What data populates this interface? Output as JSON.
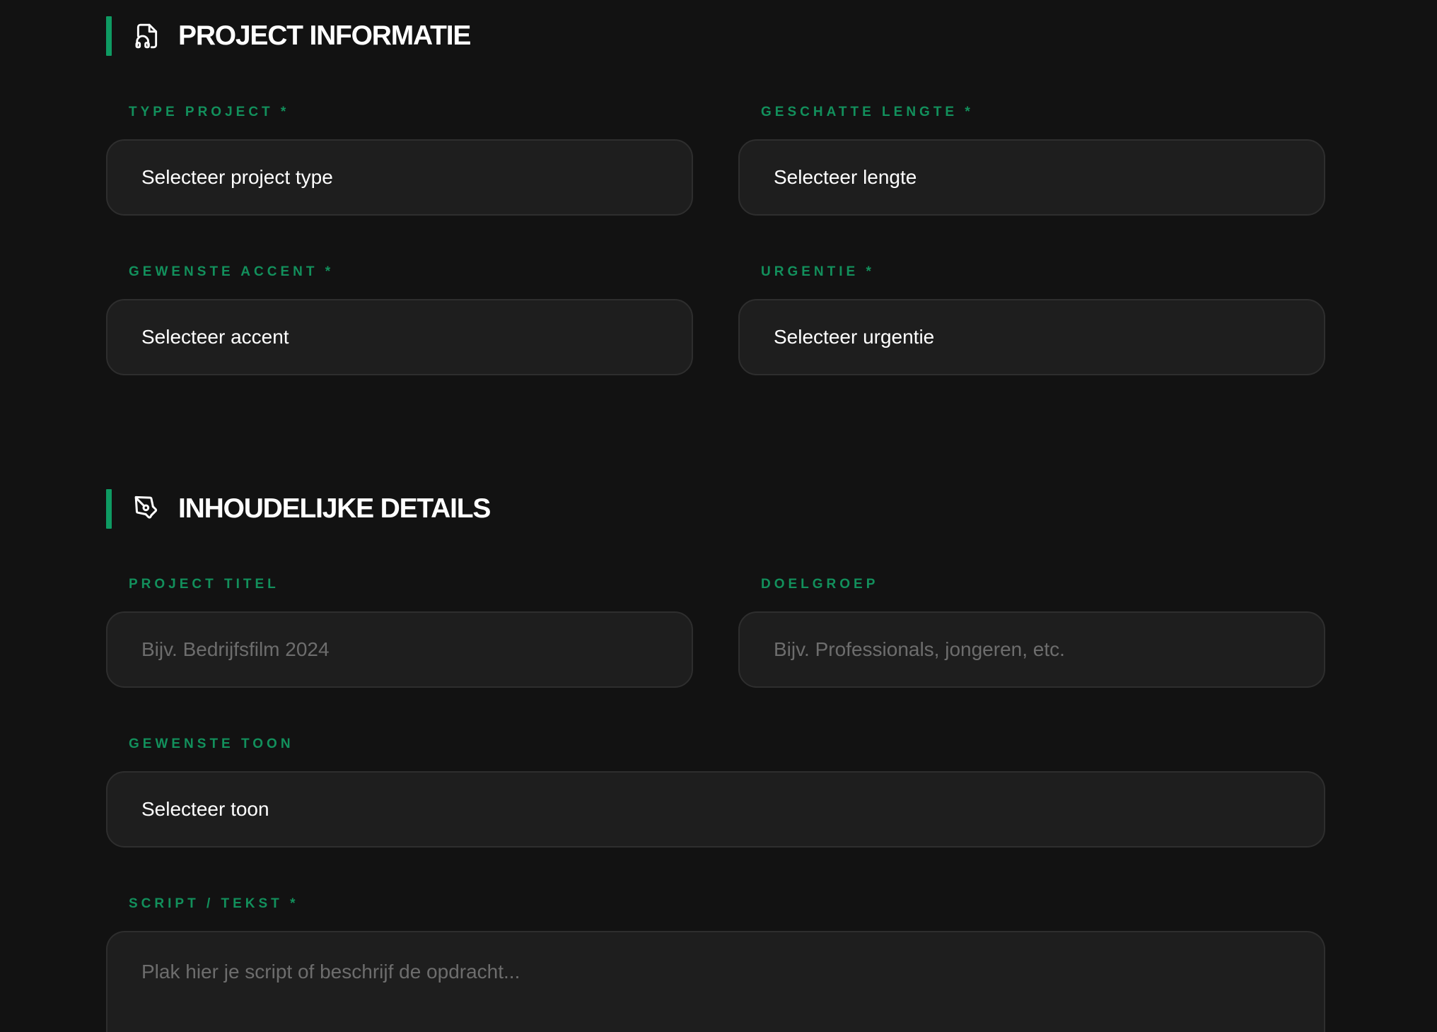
{
  "colors": {
    "background": "#121212",
    "accent": "#0e9a62",
    "label": "#12905c",
    "field_bg": "#1e1e1e",
    "field_border": "#2e2e2e",
    "placeholder": "#6d6d6d"
  },
  "project_info": {
    "icon": "document-headphones-icon",
    "title": "PROJECT INFORMATIE",
    "type_project": {
      "label": "TYPE PROJECT *",
      "value": "Selecteer project type"
    },
    "geschatte_lengte": {
      "label": "GESCHATTE LENGTE *",
      "value": "Selecteer lengte"
    },
    "gewenste_accent": {
      "label": "GEWENSTE ACCENT *",
      "value": "Selecteer accent"
    },
    "urgentie": {
      "label": "URGENTIE *",
      "value": "Selecteer urgentie"
    }
  },
  "content_details": {
    "icon": "pen-tool-icon",
    "title": "INHOUDELIJKE DETAILS",
    "project_titel": {
      "label": "PROJECT TITEL",
      "placeholder": "Bijv. Bedrijfsfilm 2024"
    },
    "doelgroep": {
      "label": "DOELGROEP",
      "placeholder": "Bijv. Professionals, jongeren, etc."
    },
    "gewenste_toon": {
      "label": "GEWENSTE TOON",
      "value": "Selecteer toon"
    },
    "script": {
      "label": "SCRIPT / TEKST *",
      "placeholder": "Plak hier je script of beschrijf de opdracht..."
    }
  }
}
